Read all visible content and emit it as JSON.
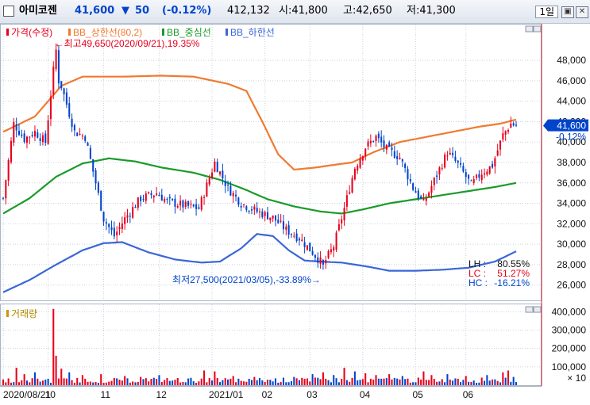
{
  "header": {
    "stock_name": "아미코젠",
    "price": "41,600",
    "change_arrow": "▼",
    "change": "50",
    "change_pct": "(-0.12%)",
    "volume": "412,132",
    "open": "시:41,800",
    "high": "고:42,650",
    "low": "저:41,300",
    "period": "1일",
    "accent_up": "#e8001c",
    "accent_down": "#0044cc"
  },
  "chart_data": {
    "type": "line",
    "legend": [
      {
        "name": "가격(수정)",
        "color": "#e8001c"
      },
      {
        "name": "BB_상한선(80,2)",
        "color": "#f07a30"
      },
      {
        "name": "BB_중심선",
        "color": "#1a9a2a"
      },
      {
        "name": "BB_하한선",
        "color": "#3a66d8"
      }
    ],
    "price_axis": {
      "ticks": [
        "48,000",
        "46,000",
        "44,000",
        "42,000",
        "40,000",
        "38,000",
        "36,000",
        "34,000",
        "32,000",
        "30,000",
        "28,000",
        "26,000"
      ],
      "tick_values": [
        48000,
        46000,
        44000,
        42000,
        40000,
        38000,
        36000,
        34000,
        32000,
        30000,
        28000,
        26000
      ],
      "range": [
        24500,
        51500
      ],
      "current_price": "41,600",
      "current_change": "-0.12%"
    },
    "time_axis": {
      "labels": [
        "2020/08/21",
        "10",
        "11",
        "12",
        "2021/01",
        "02",
        "03",
        "04",
        "05",
        "06"
      ],
      "label_index": [
        0,
        17,
        38,
        59,
        79,
        99,
        116,
        136,
        156,
        175
      ]
    },
    "n_days": 195,
    "price_keypoints": [
      [
        0,
        34500
      ],
      [
        4,
        41800
      ],
      [
        8,
        40300
      ],
      [
        12,
        41000
      ],
      [
        16,
        40000
      ],
      [
        19,
        47000
      ],
      [
        22,
        45500
      ],
      [
        27,
        41000
      ],
      [
        31,
        40500
      ],
      [
        35,
        36000
      ],
      [
        38,
        32500
      ],
      [
        42,
        30800
      ],
      [
        46,
        32500
      ],
      [
        52,
        34500
      ],
      [
        58,
        35000
      ],
      [
        62,
        34200
      ],
      [
        68,
        33800
      ],
      [
        74,
        33500
      ],
      [
        80,
        38000
      ],
      [
        85,
        35500
      ],
      [
        90,
        34000
      ],
      [
        96,
        33200
      ],
      [
        102,
        32600
      ],
      [
        107,
        31400
      ],
      [
        112,
        30600
      ],
      [
        117,
        29200
      ],
      [
        121,
        28000
      ],
      [
        125,
        29800
      ],
      [
        129,
        33500
      ],
      [
        133,
        37500
      ],
      [
        137,
        39500
      ],
      [
        141,
        40500
      ],
      [
        145,
        39300
      ],
      [
        150,
        38500
      ],
      [
        155,
        35500
      ],
      [
        159,
        34000
      ],
      [
        164,
        36800
      ],
      [
        168,
        39000
      ],
      [
        172,
        37800
      ],
      [
        177,
        35800
      ],
      [
        181,
        37000
      ],
      [
        185,
        37700
      ],
      [
        189,
        40700
      ],
      [
        192,
        41800
      ],
      [
        194,
        41600
      ]
    ],
    "upper_band_keypoints": [
      [
        0,
        41000
      ],
      [
        12,
        42500
      ],
      [
        22,
        45500
      ],
      [
        30,
        46400
      ],
      [
        45,
        46400
      ],
      [
        60,
        46500
      ],
      [
        72,
        46400
      ],
      [
        85,
        45700
      ],
      [
        92,
        45000
      ],
      [
        98,
        42000
      ],
      [
        104,
        38800
      ],
      [
        110,
        37300
      ],
      [
        118,
        37500
      ],
      [
        126,
        37800
      ],
      [
        132,
        38000
      ],
      [
        140,
        39000
      ],
      [
        150,
        40000
      ],
      [
        160,
        40500
      ],
      [
        170,
        41000
      ],
      [
        180,
        41500
      ],
      [
        188,
        41800
      ],
      [
        194,
        42200
      ]
    ],
    "middle_band_keypoints": [
      [
        0,
        33000
      ],
      [
        10,
        34500
      ],
      [
        20,
        36600
      ],
      [
        30,
        37900
      ],
      [
        40,
        38400
      ],
      [
        50,
        38100
      ],
      [
        60,
        37500
      ],
      [
        72,
        37000
      ],
      [
        82,
        36300
      ],
      [
        92,
        35300
      ],
      [
        100,
        34400
      ],
      [
        110,
        33700
      ],
      [
        120,
        33200
      ],
      [
        128,
        33000
      ],
      [
        136,
        33400
      ],
      [
        146,
        34000
      ],
      [
        156,
        34400
      ],
      [
        166,
        34800
      ],
      [
        176,
        35200
      ],
      [
        186,
        35600
      ],
      [
        194,
        36000
      ]
    ],
    "lower_band_keypoints": [
      [
        0,
        25300
      ],
      [
        10,
        26500
      ],
      [
        20,
        28000
      ],
      [
        30,
        29400
      ],
      [
        38,
        30100
      ],
      [
        45,
        30200
      ],
      [
        55,
        29200
      ],
      [
        65,
        28500
      ],
      [
        75,
        28200
      ],
      [
        82,
        28300
      ],
      [
        90,
        29600
      ],
      [
        96,
        31000
      ],
      [
        102,
        30800
      ],
      [
        108,
        29400
      ],
      [
        114,
        28400
      ],
      [
        120,
        28300
      ],
      [
        128,
        28200
      ],
      [
        138,
        27800
      ],
      [
        146,
        27400
      ],
      [
        156,
        27400
      ],
      [
        166,
        27500
      ],
      [
        176,
        27700
      ],
      [
        186,
        28300
      ],
      [
        194,
        29300
      ]
    ],
    "max_annotation": "←최고49,650(2020/09/21),19.35%",
    "max_index": 20,
    "max_value": 49650,
    "min_annotation": "최저27,500(2021/03/05),-33.89%→",
    "min_index": 121,
    "min_value": 27500,
    "stats": [
      {
        "label": "LH :",
        "value": "80.55%",
        "color": "#111111"
      },
      {
        "label": "LC :",
        "value": "51.27%",
        "color": "#e8001c"
      },
      {
        "label": "HC :",
        "value": "-16.21%",
        "color": "#0044cc"
      }
    ],
    "volume_panel": {
      "legend": "거래량",
      "ticks": [
        "400,000",
        "300,000",
        "200,000",
        "100,000"
      ],
      "tick_values": [
        400000,
        300000,
        200000,
        100000
      ],
      "range": [
        0,
        440000
      ],
      "multiplier": "× 10",
      "avg_volume": 32000,
      "spikes": [
        [
          5,
          95000
        ],
        [
          8,
          60000
        ],
        [
          12,
          70000
        ],
        [
          19,
          415000
        ],
        [
          20,
          160000
        ],
        [
          22,
          90000
        ],
        [
          25,
          70000
        ],
        [
          30,
          55000
        ],
        [
          37,
          60000
        ],
        [
          46,
          50000
        ],
        [
          52,
          45000
        ],
        [
          59,
          55000
        ],
        [
          76,
          80000
        ],
        [
          80,
          75000
        ],
        [
          87,
          50000
        ],
        [
          95,
          45000
        ],
        [
          110,
          45000
        ],
        [
          117,
          60000
        ],
        [
          121,
          70000
        ],
        [
          125,
          55000
        ],
        [
          129,
          95000
        ],
        [
          133,
          75000
        ],
        [
          137,
          65000
        ],
        [
          141,
          55000
        ],
        [
          146,
          60000
        ],
        [
          151,
          50000
        ],
        [
          159,
          75000
        ],
        [
          162,
          55000
        ],
        [
          168,
          60000
        ],
        [
          175,
          50000
        ],
        [
          183,
          55000
        ],
        [
          189,
          70000
        ],
        [
          191,
          80000
        ],
        [
          193,
          45000
        ]
      ]
    }
  }
}
